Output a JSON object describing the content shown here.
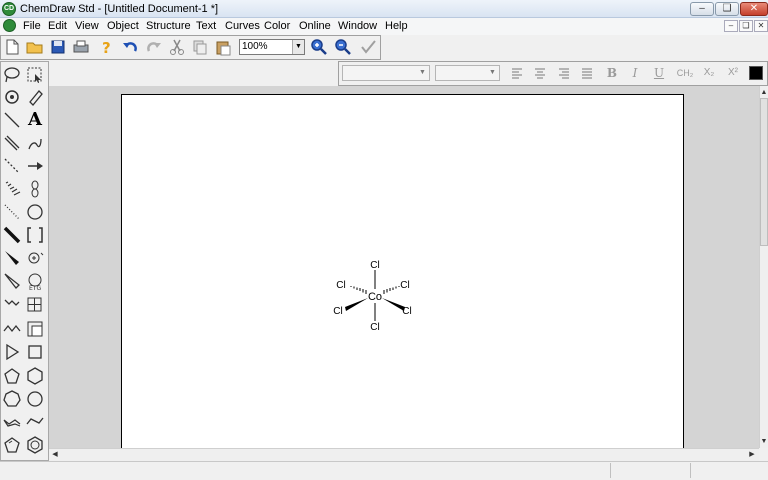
{
  "window": {
    "title": "ChemDraw Std - [Untitled Document-1 *]"
  },
  "menu": {
    "items": [
      "File",
      "Edit",
      "View",
      "Object",
      "Structure",
      "Text",
      "Curves",
      "Color",
      "Online",
      "Window",
      "Help"
    ]
  },
  "toolbar": {
    "zoom_value": "100%"
  },
  "stylebar": {
    "bold": "B",
    "italic": "I",
    "underline": "U",
    "formula": "CH₂",
    "subscript": "X₂",
    "superscript": "X²"
  },
  "palette": {
    "text_tool": "A"
  },
  "molecule": {
    "center": "Co",
    "ligands": [
      "Cl",
      "Cl",
      "Cl",
      "Cl",
      "Cl",
      "Cl"
    ]
  },
  "colors": {
    "title_bar": "#dde7f3",
    "accent_green": "#2e8b3a",
    "close_red": "#c4402b",
    "undo_blue": "#1e50b4"
  }
}
